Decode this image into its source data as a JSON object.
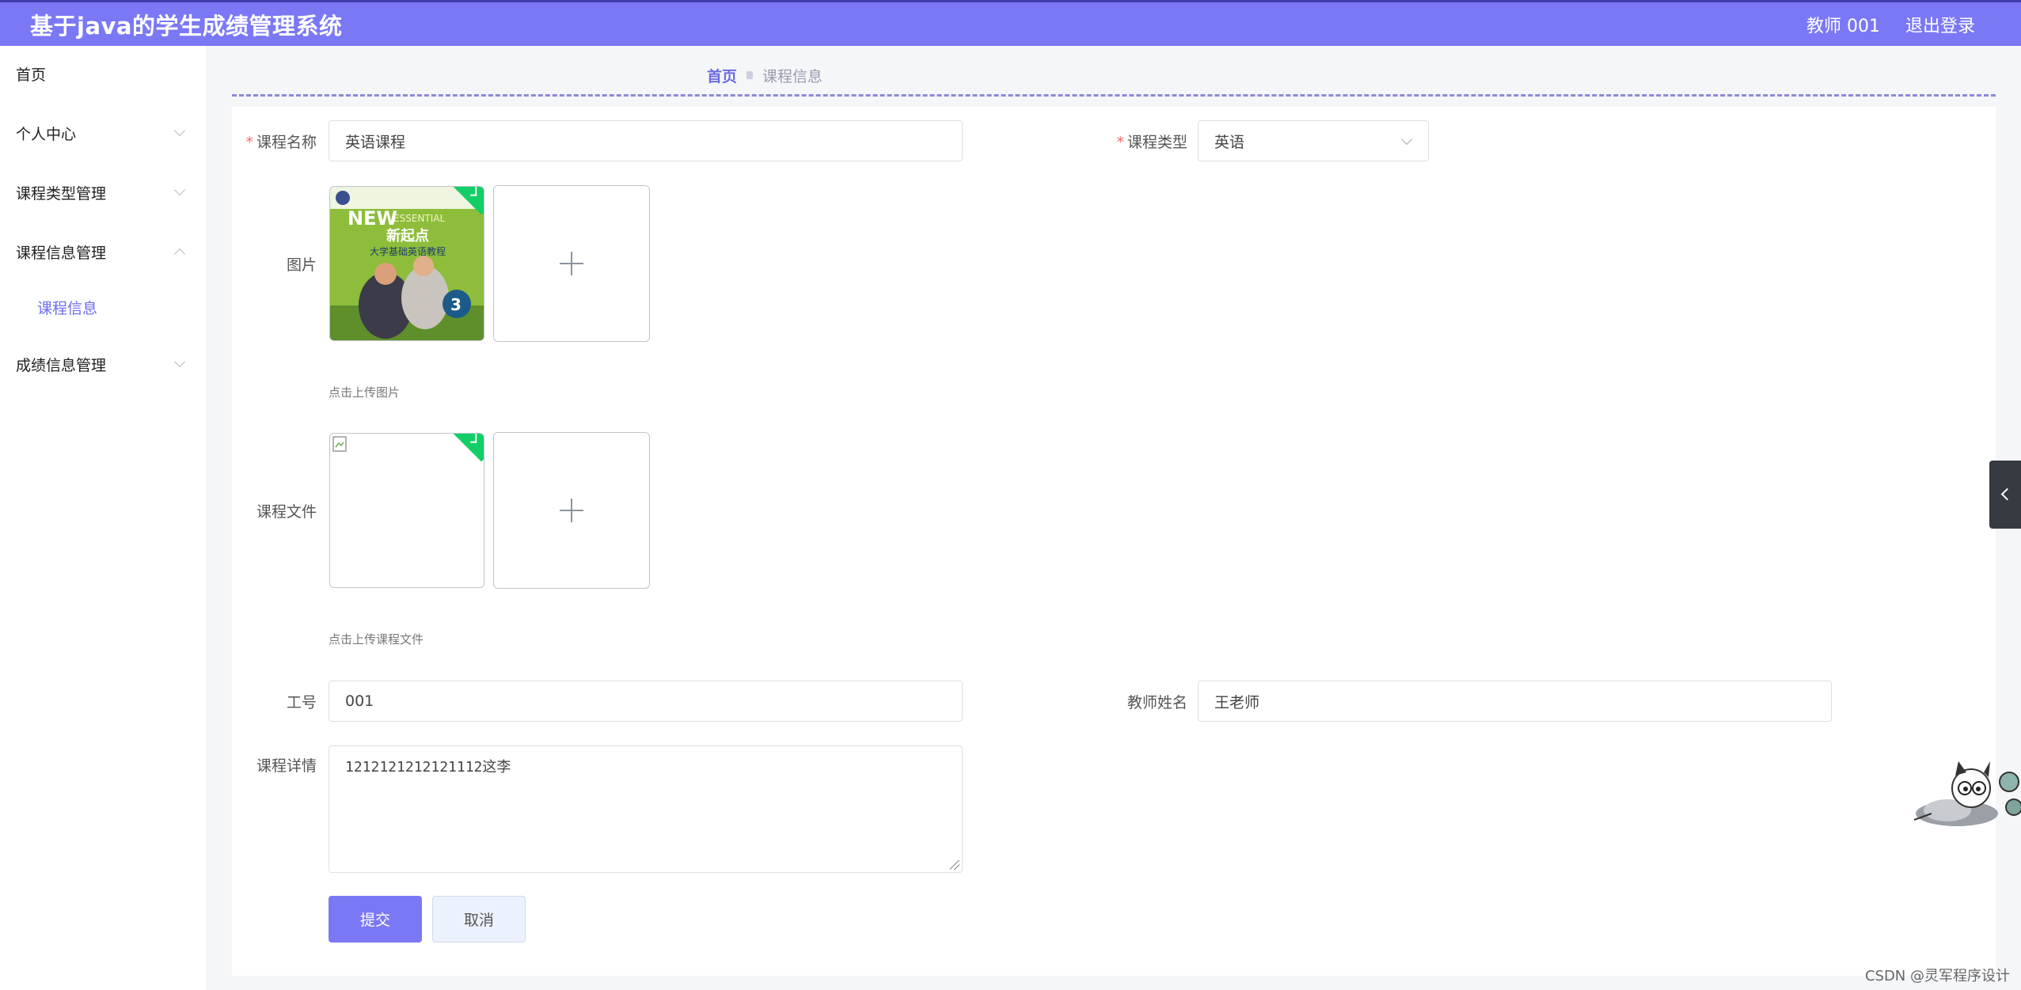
{
  "header": {
    "title": "基于java的学生成绩管理系统",
    "user": "教师 001",
    "logout": "退出登录"
  },
  "sidebar": {
    "items": [
      {
        "label": "首页"
      },
      {
        "label": "个人中心"
      },
      {
        "label": "课程类型管理"
      },
      {
        "label": "课程信息管理"
      },
      {
        "label": "成绩信息管理"
      }
    ],
    "sub_item": "课程信息"
  },
  "breadcrumb": {
    "home": "首页",
    "current": "课程信息"
  },
  "form": {
    "course_name": {
      "label": "课程名称",
      "value": "英语课程"
    },
    "course_type": {
      "label": "课程类型",
      "value": "英语"
    },
    "picture": {
      "label": "图片",
      "hint": "点击上传图片"
    },
    "file": {
      "label": "课程文件",
      "hint": "点击上传课程文件"
    },
    "teacher_no": {
      "label": "工号",
      "value": "001"
    },
    "teacher_name": {
      "label": "教师姓名",
      "value": "王老师"
    },
    "details": {
      "label": "课程详情",
      "value": "1212121212121112这李"
    },
    "submit": "提交",
    "cancel": "取消"
  },
  "book_cover": {
    "brand": "NEW",
    "brand_suffix": "ESSENTIAL",
    "title": "新起点",
    "subtitle": "大学基础英语教程",
    "badge": "3"
  },
  "watermark": "CSDN @灵军程序设计"
}
